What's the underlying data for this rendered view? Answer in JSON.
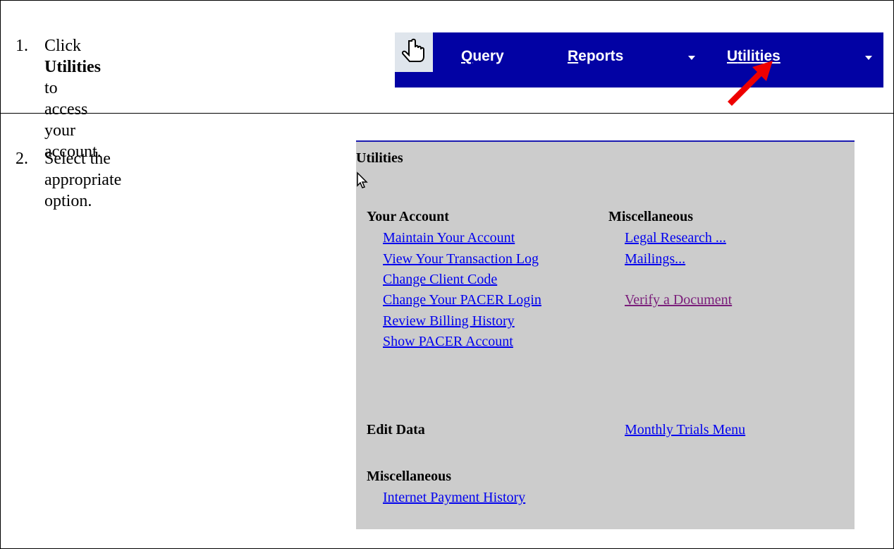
{
  "steps": [
    {
      "number": "1.",
      "prefix": "Click ",
      "bold": "Utilities",
      "suffix": " to access",
      "line2": "your account."
    },
    {
      "number": "2.",
      "line1": "Select the appropriate",
      "line2": "option."
    }
  ],
  "toolbar": {
    "items": [
      {
        "accel": "Q",
        "rest": "uery"
      },
      {
        "accel": "R",
        "rest": "eports"
      },
      {
        "accel": "U",
        "rest": "tilities"
      }
    ],
    "colors": {
      "background": "#0202a4",
      "text": "#ffffff",
      "arrow": "#ee0000"
    }
  },
  "utilities": {
    "title": "Utilities",
    "your_account": {
      "heading": "Your Account",
      "links": [
        "Maintain Your Account",
        "View Your Transaction Log",
        "Change Client Code",
        "Change Your PACER Login",
        "Review Billing History",
        "Show PACER Account"
      ]
    },
    "misc_right": {
      "heading": "Miscellaneous",
      "links": [
        "Legal Research ...",
        "Mailings...",
        "Verify a Document"
      ]
    },
    "edit_data": {
      "heading": "Edit Data",
      "link": "Monthly Trials Menu"
    },
    "misc_bottom": {
      "heading": "Miscellaneous",
      "link": "Internet Payment History"
    },
    "colors": {
      "panel": "#cccccc",
      "link": "#0000ee",
      "visited": "#7a1d7a"
    }
  }
}
